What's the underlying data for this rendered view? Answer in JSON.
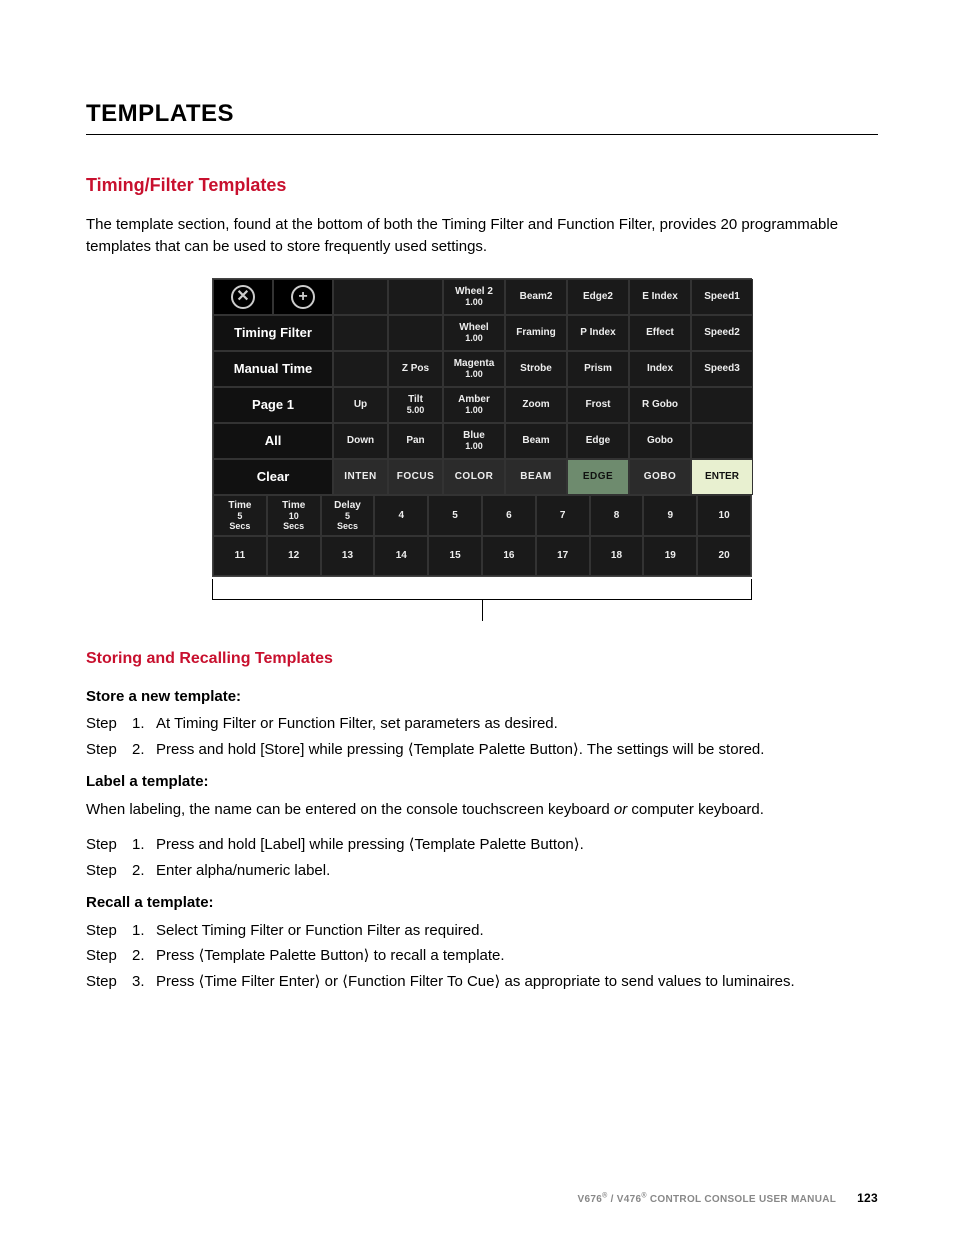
{
  "heading": "TEMPLATES",
  "sub1_title": "Timing/Filter Templates",
  "sub1_body": "The template section, found at the bottom of both the Timing Filter and Function Filter, provides 20 programmable templates that can be used to store frequently used settings.",
  "panel": {
    "side": {
      "timing_filter": "Timing Filter",
      "manual_time": "Manual Time",
      "page": "Page 1",
      "all": "All",
      "clear": "Clear"
    },
    "rows": [
      [
        "",
        "",
        "Wheel 2\n1.00",
        "Beam2",
        "Edge2",
        "E Index",
        "Speed1"
      ],
      [
        "",
        "",
        "Wheel\n1.00",
        "Framing",
        "P Index",
        "Effect",
        "Speed2"
      ],
      [
        "",
        "Z Pos",
        "Magenta\n1.00",
        "Strobe",
        "Prism",
        "Index",
        "Speed3"
      ],
      [
        "Up",
        "Tilt\n5.00",
        "Amber\n1.00",
        "Zoom",
        "Frost",
        "R Gobo",
        ""
      ],
      [
        "Down",
        "Pan",
        "Blue\n1.00",
        "Beam",
        "Edge",
        "Gobo",
        ""
      ]
    ],
    "cats": [
      "INTEN",
      "FOCUS",
      "COLOR",
      "BEAM",
      "EDGE",
      "GOBO",
      "ENTER"
    ],
    "templates_r1": [
      "Time\n5\nSecs",
      "Time\n10\nSecs",
      "Delay\n5\nSecs",
      "4",
      "5",
      "6",
      "7",
      "8",
      "9",
      "10"
    ],
    "templates_r2": [
      "11",
      "12",
      "13",
      "14",
      "15",
      "16",
      "17",
      "18",
      "19",
      "20"
    ]
  },
  "sub2_title": "Storing and Recalling Templates",
  "store_h": "Store a new template:",
  "store_s1": "At Timing Filter or Function Filter, set parameters as desired.",
  "store_s2": "Press and hold [Store] while pressing ⟨Template Palette Button⟩. The settings will be stored.",
  "label_h": "Label a template:",
  "label_p_a": "When labeling, the name can be entered on the console touchscreen keyboard ",
  "label_p_or": "or",
  "label_p_b": " computer keyboard.",
  "label_s1": "Press and hold [Label] while pressing ⟨Template Palette Button⟩.",
  "label_s2": "Enter alpha/numeric label.",
  "recall_h": "Recall a template:",
  "recall_s1": "Select Timing Filter or Function Filter as required.",
  "recall_s2": "Press ⟨Template Palette Button⟩ to recall a template.",
  "recall_s3": "Press ⟨Time Filter Enter⟩ or ⟨Function Filter To Cue⟩ as appropriate to send values to luminaires.",
  "step_word": "Step",
  "footer": {
    "left": "V676",
    "mid": " / V476",
    "right": " CONTROL CONSOLE USER MANUAL",
    "page": "123"
  }
}
